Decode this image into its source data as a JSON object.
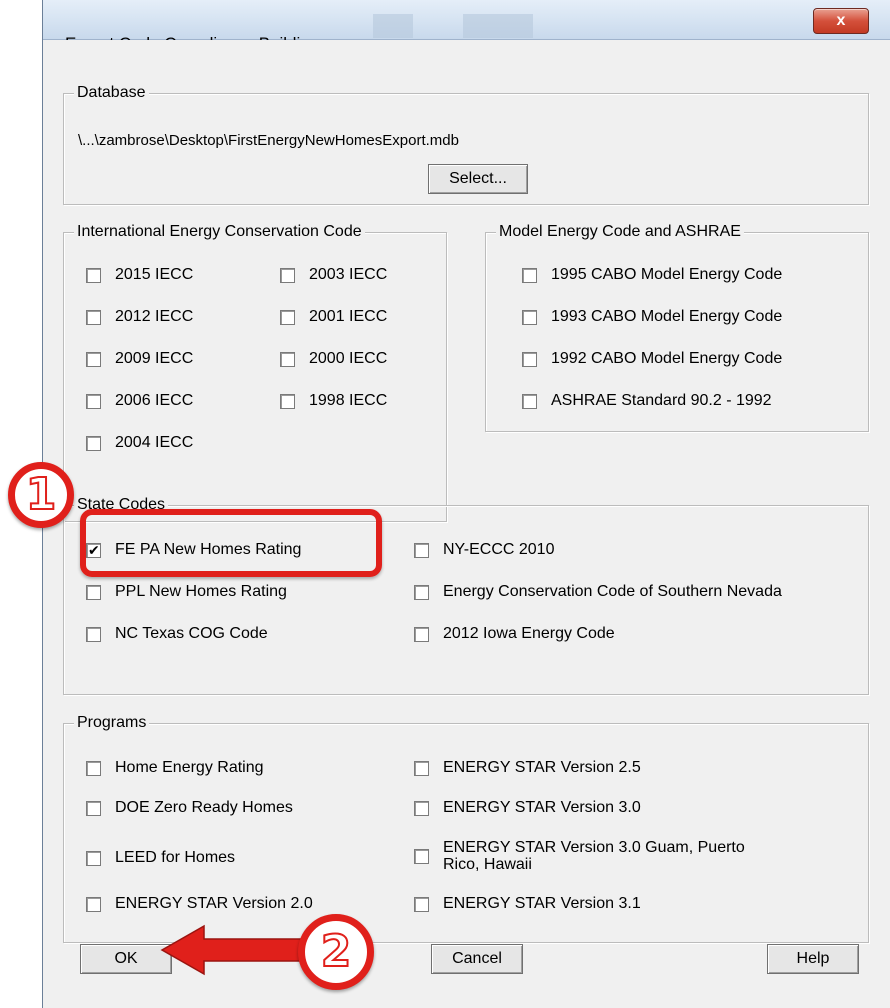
{
  "window": {
    "title": "Export Code Compliance Buildings",
    "close_label": "x"
  },
  "database": {
    "group_title": "Database",
    "path": "\\...\\zambrose\\Desktop\\FirstEnergyNewHomesExport.mdb",
    "select_label": "Select..."
  },
  "iecc": {
    "group_title": "International Energy Conservation Code",
    "items": [
      {
        "label": "2015 IECC",
        "checked": false
      },
      {
        "label": "2012 IECC",
        "checked": false
      },
      {
        "label": "2009 IECC",
        "checked": false
      },
      {
        "label": "2006 IECC",
        "checked": false
      },
      {
        "label": "2004 IECC",
        "checked": false
      },
      {
        "label": "2003 IECC",
        "checked": false
      },
      {
        "label": "2001 IECC",
        "checked": false
      },
      {
        "label": "2000 IECC",
        "checked": false
      },
      {
        "label": "1998 IECC",
        "checked": false
      }
    ]
  },
  "model": {
    "group_title": "Model Energy Code and ASHRAE",
    "items": [
      {
        "label": "1995 CABO Model Energy Code",
        "checked": false
      },
      {
        "label": "1993 CABO Model Energy Code",
        "checked": false
      },
      {
        "label": "1992 CABO Model Energy Code",
        "checked": false
      },
      {
        "label": "ASHRAE Standard 90.2 - 1992",
        "checked": false
      }
    ]
  },
  "state": {
    "group_title": "State Codes",
    "items": [
      {
        "label": "FE PA New Homes Rating",
        "checked": true
      },
      {
        "label": "PPL New Homes Rating",
        "checked": false
      },
      {
        "label": "NC Texas COG Code",
        "checked": false
      },
      {
        "label": "NY-ECCC 2010",
        "checked": false
      },
      {
        "label": "Energy Conservation Code of Southern Nevada",
        "checked": false
      },
      {
        "label": "2012 Iowa Energy Code",
        "checked": false
      }
    ]
  },
  "programs": {
    "group_title": "Programs",
    "items": [
      {
        "label": "Home Energy Rating",
        "checked": false
      },
      {
        "label": "DOE Zero Ready Homes",
        "checked": false
      },
      {
        "label": "LEED for Homes",
        "checked": false
      },
      {
        "label": "ENERGY STAR Version 2.0",
        "checked": false
      },
      {
        "label": "ENERGY STAR Version 2.5",
        "checked": false
      },
      {
        "label": "ENERGY STAR Version 3.0",
        "checked": false
      },
      {
        "label": "ENERGY STAR Version 3.0 Guam, Puerto Rico, Hawaii",
        "checked": false
      },
      {
        "label": "ENERGY STAR Version 3.1",
        "checked": false
      }
    ]
  },
  "buttons": {
    "ok": "OK",
    "cancel": "Cancel",
    "help": "Help"
  },
  "annotations": {
    "step1": "1",
    "step2": "2",
    "color": "#e0201b"
  }
}
